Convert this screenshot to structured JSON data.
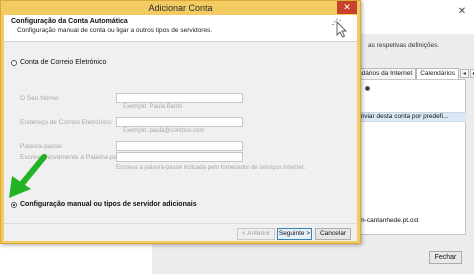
{
  "background_window": {
    "close_glyph": "✕",
    "description": "as respetivas definições.",
    "tabs": [
      {
        "label": "ndários da Internet"
      },
      {
        "label": "Calendários"
      }
    ],
    "tab_prev": "◂",
    "tab_next": "▸",
    "list_selected_text": "enviar desta conta por predefi...",
    "server_text": "cm-cantanhede.pt.ost",
    "bottom_button": "Fechar"
  },
  "dialog": {
    "title": "Adicionar Conta",
    "close_glyph": "✕",
    "header": {
      "title": "Configuração da Conta Automática",
      "subtitle": "Configuração manual de conta ou ligar a outros tipos de servidores.",
      "icon": "cursor-click-icon"
    },
    "option_email": {
      "label": "Conta de Correio Eletrónico",
      "checked": false
    },
    "fields": [
      {
        "label": "O Seu Nome:",
        "value": "",
        "hint": "Exemplo: Paula Benfo"
      },
      {
        "label": "Endereço de Correio Eletrónico:",
        "value": "",
        "hint": "Exemplo: paula@contoso.com"
      },
      {
        "label": "Palavra-passe:",
        "value": ""
      },
      {
        "label": "Escreva Novamente a Palavra-passe:",
        "value": "",
        "hint": "Escreva a palavra-passe indicada pelo fornecedor de serviços Internet."
      }
    ],
    "option_manual": {
      "label": "Configuração manual ou tipos de servidor adicionais",
      "checked": true
    },
    "buttons": {
      "back": "< Anterior",
      "next": "Seguinte >",
      "cancel": "Cancelar"
    },
    "annotation": {
      "icon": "green-arrow-icon",
      "color": "#22b324"
    }
  }
}
